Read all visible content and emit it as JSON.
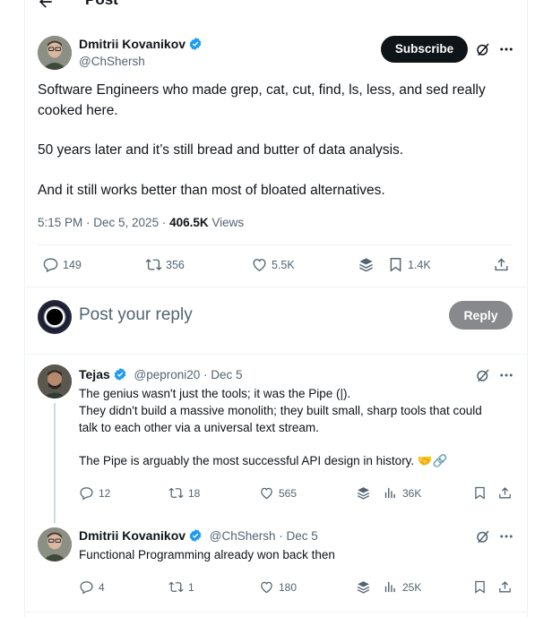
{
  "header": {
    "title": "Post"
  },
  "post": {
    "author_name": "Dmitrii Kovanikov",
    "author_handle": "@ChShersh",
    "subscribe_label": "Subscribe",
    "text_p1": "Software Engineers who made grep, cat, cut, find, ls, less, and sed really cooked here.",
    "text_p2": "50 years later and it’s still bread and butter of data analysis.",
    "text_p3": "And it still works better than most of bloated alternatives.",
    "time": "5:15 PM · Dec 5, 2025 · ",
    "views_count": "406.5K",
    "views_label": " Views",
    "stats": {
      "replies": "149",
      "reposts": "356",
      "likes": "5.5K",
      "bookmarks": "1.4K"
    }
  },
  "composer": {
    "placeholder": "Post your reply",
    "reply_label": "Reply"
  },
  "replies": [
    {
      "author_name": "Tejas",
      "author_handle": "@peproni20",
      "date": " · Dec 5",
      "text_lines": [
        "The genius wasn't just the tools; it was the Pipe (|).",
        "They didn't build a massive monolith; they built small, sharp tools that could talk to each other via a universal text stream."
      ],
      "text_p2": "The Pipe is arguably the most successful API design in history. 🤝🔗",
      "stats": {
        "replies": "12",
        "reposts": "18",
        "likes": "565",
        "views": "36K"
      }
    },
    {
      "author_name": "Dmitrii Kovanikov",
      "author_handle": "@ChShersh",
      "date": " · Dec 5",
      "text_lines": [
        "Functional Programming already won back then"
      ],
      "stats": {
        "replies": "4",
        "reposts": "1",
        "likes": "180",
        "views": "25K"
      }
    }
  ],
  "colors": {
    "text": "#0f1419",
    "secondary": "#536471",
    "verified": "#1d9bf0",
    "border": "#eff3f4"
  }
}
